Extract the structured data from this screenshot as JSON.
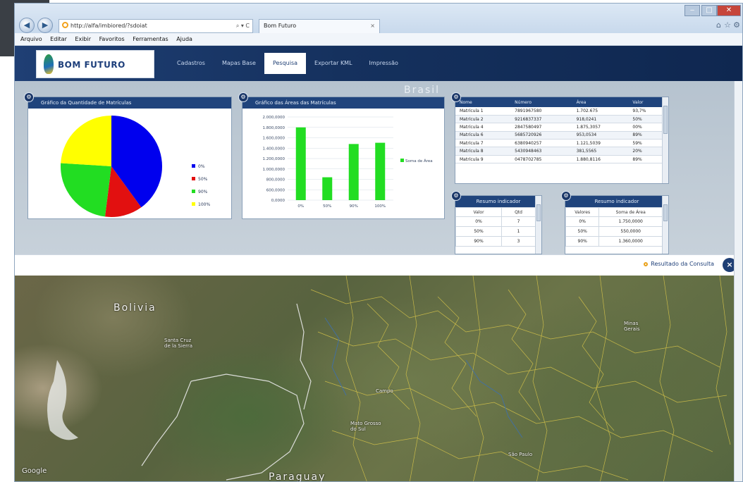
{
  "browser": {
    "address": "http://alfa/imbiored/?sdoiat",
    "address_tools": "⌕ ▾ C",
    "tab_title": "Bom Futuro",
    "tab_close": "×",
    "menu": [
      "Arquivo",
      "Editar",
      "Exibir",
      "Favoritos",
      "Ferramentas",
      "Ajuda"
    ]
  },
  "app": {
    "logo_text": "BOM FUTURO",
    "tabs": [
      "Cadastros",
      "Mapas Base",
      "Pesquisa",
      "Exportar KML",
      "Impressão"
    ],
    "active_tab": "Pesquisa",
    "watermark": "Brasil"
  },
  "pie_panel": {
    "title": "Gráfico da Quantidade de Matrículas"
  },
  "bar_panel": {
    "title": "Gráfico das Áreas das Matrículas"
  },
  "chart_data": [
    {
      "type": "pie",
      "title": "Gráfico da Quantidade de Matrículas",
      "categories": [
        "0%",
        "50%",
        "90%",
        "100%"
      ],
      "values": [
        40,
        12,
        24,
        24
      ],
      "colors": [
        "#0000ee",
        "#e21010",
        "#22dd22",
        "#ffff00"
      ],
      "legend_position": "right"
    },
    {
      "type": "bar",
      "title": "Gráfico das Áreas das Matrículas",
      "categories": [
        "0%",
        "50%",
        "90%",
        "100%"
      ],
      "series": [
        {
          "name": "Soma de Área",
          "values": [
            1750000,
            550000,
            1350000,
            1380000
          ]
        }
      ],
      "y_ticks": [
        "2.000,0000",
        "1.800,0000",
        "1.600,0000",
        "1.400,0000",
        "1.200,0000",
        "1.000,0000",
        "800,0000",
        "600,0000",
        "0,0000"
      ],
      "ylim": [
        0,
        2000000
      ],
      "grid": true,
      "color": "#22dd22",
      "legend_position": "right"
    }
  ],
  "table": {
    "columns": [
      "Nome",
      "Número",
      "Área",
      "Valor"
    ],
    "rows": [
      [
        "Matrícula 1",
        "7891967580",
        "1.702.675",
        "93,7%"
      ],
      [
        "Matrícula 2",
        "9216837337",
        "918,0241",
        "50%"
      ],
      [
        "Matrícula 4",
        "2847580497",
        "1.875,3057",
        "00%"
      ],
      [
        "Matrícula 6",
        "5685720926",
        "953,0534",
        "89%"
      ],
      [
        "Matrícula 7",
        "6380940257",
        "1.121,5039",
        "59%"
      ],
      [
        "Matrícula 8",
        "5430948463",
        "381,5565",
        "20%"
      ],
      [
        "Matrícula 9",
        "0478702785",
        "1.880,8116",
        "89%"
      ]
    ]
  },
  "resumo1": {
    "title": "Resumo indicador",
    "columns": [
      "Valor",
      "Qtd"
    ],
    "rows": [
      [
        "0%",
        "7"
      ],
      [
        "50%",
        "1"
      ],
      [
        "90%",
        "3"
      ]
    ]
  },
  "resumo2": {
    "title": "Resumo indicador",
    "columns": [
      "Valores",
      "Soma de Área"
    ],
    "rows": [
      [
        "0%",
        "1.750,0000"
      ],
      [
        "50%",
        "550,0000"
      ],
      [
        "90%",
        "1.360,0000"
      ]
    ]
  },
  "result_bar": {
    "link_text": "Resultado da Consulta",
    "close_text": "×"
  },
  "map": {
    "labels": {
      "bolivia": "Bolivia",
      "paraguay": "Paraguay",
      "google": "Google",
      "campo": "Campo",
      "mato_grosso": "Mato Grosso\ndo Sul",
      "sao_paulo": "São Paulo",
      "minas": "Minas\nGerais",
      "santa_cruz": "Santa Cruz\nde la Sierra"
    }
  }
}
